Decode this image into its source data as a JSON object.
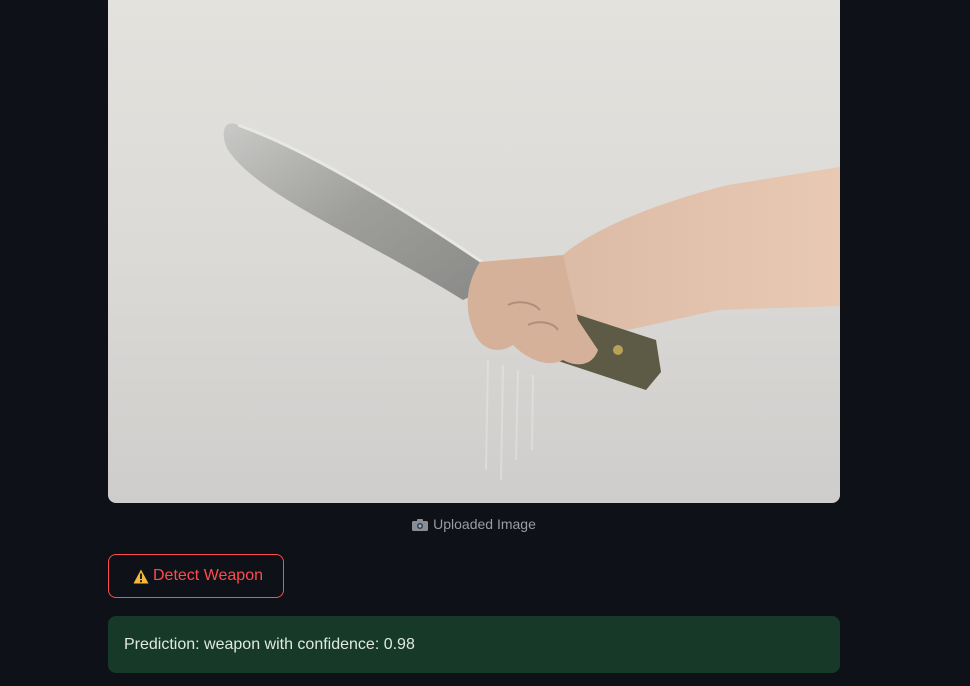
{
  "uploaded_image": {
    "caption_icon": "camera-icon",
    "caption": "Uploaded Image"
  },
  "detect_button": {
    "icon": "warning-icon",
    "label": "Detect Weapon"
  },
  "result": {
    "text": "Prediction: weapon with confidence: 0.98"
  },
  "colors": {
    "background": "#0e1117",
    "accent": "#ff4b4b",
    "success_bg": "#173928"
  }
}
